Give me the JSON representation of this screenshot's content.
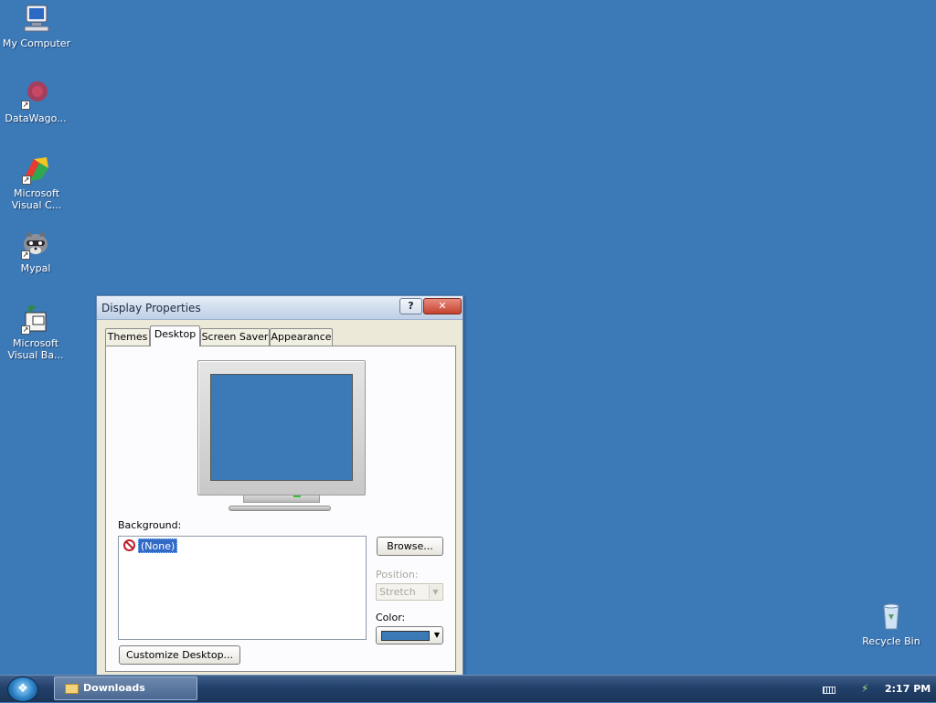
{
  "desktop": {
    "icons": [
      {
        "label": "My Computer",
        "icon": "computer-icon"
      },
      {
        "label": "DataWago...",
        "icon": "datawagon-icon"
      },
      {
        "label": "Microsoft Visual C...",
        "icon": "visual-cpp-icon"
      },
      {
        "label": "Mypal",
        "icon": "mypal-icon"
      },
      {
        "label": "Microsoft Visual Ba...",
        "icon": "visual-basic-icon"
      },
      {
        "label": "Recycle Bin",
        "icon": "recycle-bin-icon"
      }
    ]
  },
  "window": {
    "title": "Display Properties",
    "help_symbol": "?",
    "close_symbol": "✕",
    "tabs": [
      {
        "label": "Themes",
        "active": false
      },
      {
        "label": "Desktop",
        "active": true
      },
      {
        "label": "Screen Saver",
        "active": false
      },
      {
        "label": "Appearance",
        "active": false
      }
    ],
    "background_label": "Background:",
    "background_items": [
      {
        "label": "(None)",
        "icon": "none-icon",
        "selected": true
      }
    ],
    "browse_label": "Browse...",
    "position_label": "Position:",
    "position_value": "Stretch",
    "position_disabled": true,
    "color_label": "Color:",
    "color_value": "#3c79b7",
    "customize_label": "Customize Desktop...",
    "monitor_preview_color": "#3c79b7"
  },
  "taskbar": {
    "start_icon": "windows-start-icon",
    "items": [
      {
        "label": "Downloads",
        "icon": "folder-icon"
      }
    ],
    "tray_icons": [
      "keyboard-icon",
      "network-icon"
    ],
    "clock": "2:17 PM"
  },
  "colors": {
    "desktop_background": "#3c79b7",
    "selection": "#3169c6",
    "window_face": "#ece9d8"
  }
}
